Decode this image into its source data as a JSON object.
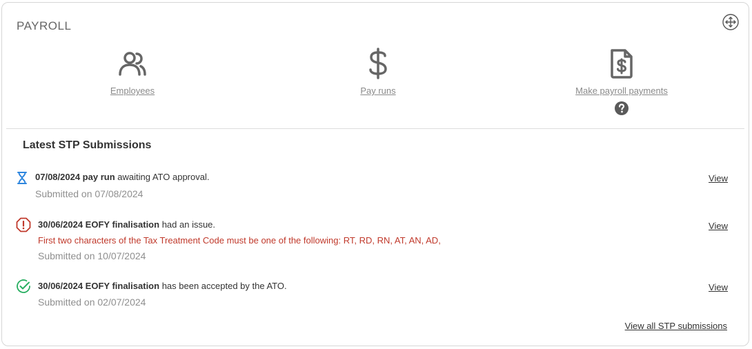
{
  "widget": {
    "title": "PAYROLL"
  },
  "icons": {
    "move": "move-icon",
    "employees": "users-icon",
    "payruns": "dollar-icon",
    "payments": "invoice-dollar-icon",
    "help": "help-icon"
  },
  "tiles": [
    {
      "label": "Employees"
    },
    {
      "label": "Pay runs"
    },
    {
      "label": "Make payroll payments"
    }
  ],
  "stp": {
    "heading": "Latest STP Submissions",
    "items": [
      {
        "status": "pending",
        "bold": "07/08/2024 pay run",
        "text": " awaiting ATO approval.",
        "submitted": "Submitted on 07/08/2024",
        "view": "View"
      },
      {
        "status": "error",
        "bold": "30/06/2024 EOFY finalisation",
        "text": " had an issue.",
        "error": "First two characters of the Tax Treatment Code must be one of the following: RT, RD, RN, AT, AN, AD,",
        "submitted": "Submitted on 10/07/2024",
        "view": "View"
      },
      {
        "status": "success",
        "bold": "30/06/2024 EOFY finalisation",
        "text": " has been accepted by the ATO.",
        "submitted": "Submitted on 02/07/2024",
        "view": "View"
      }
    ],
    "view_all": "View all STP submissions"
  },
  "colors": {
    "pending": "#2e86de",
    "error": "#c0392b",
    "success": "#27ae60",
    "icon": "#666666"
  }
}
